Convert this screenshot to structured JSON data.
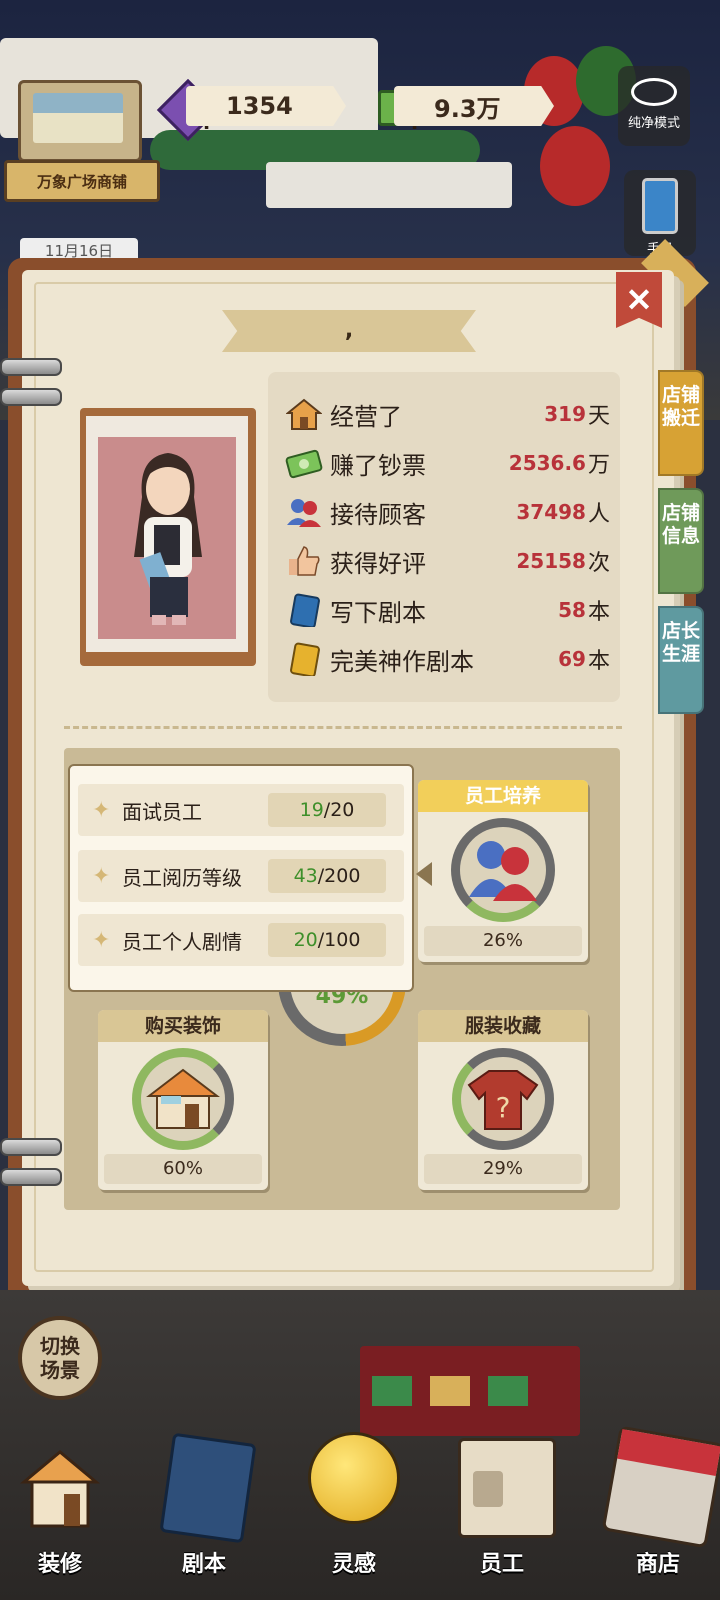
{
  "hud": {
    "shop_name": "万象广场商铺",
    "gems": "1354",
    "money": "9.3万",
    "date": "11月16日",
    "pure_mode": "纯净模式",
    "phone": "手机"
  },
  "panel": {
    "title": ",",
    "close": "✕",
    "tabs": [
      {
        "label": "店铺搬迁",
        "color": "#d7a234"
      },
      {
        "label": "店铺信息",
        "color": "#6f9a5a"
      },
      {
        "label": "店长生涯",
        "color": "#5f9aa0"
      }
    ],
    "stats": [
      {
        "label": "经营了",
        "value": "319",
        "unit": "天",
        "icon": "shop-icon"
      },
      {
        "label": "赚了钞票",
        "value": "2536.6",
        "unit": "万",
        "icon": "cash-icon"
      },
      {
        "label": "接待顾客",
        "value": "37498",
        "unit": "人",
        "icon": "customers-icon"
      },
      {
        "label": "获得好评",
        "value": "25158",
        "unit": "次",
        "icon": "thumbs-up-icon"
      },
      {
        "label": "写下剧本",
        "value": "58",
        "unit": "本",
        "icon": "script-book-icon"
      },
      {
        "label": "完美神作剧本",
        "value": "69",
        "unit": "本",
        "icon": "gold-script-icon"
      }
    ],
    "cards": {
      "staff_training": {
        "title": "员工培养",
        "percent": "26%"
      },
      "center": {
        "percent": "49%"
      },
      "buy_decor": {
        "title": "购买装饰",
        "percent": "60%"
      },
      "costume": {
        "title": "服装收藏",
        "percent": "29%"
      }
    },
    "tooltip": [
      {
        "label": "面试员工",
        "current": "19",
        "total": "/20"
      },
      {
        "label": "员工阅历等级",
        "current": "43",
        "total": "/200"
      },
      {
        "label": "员工个人剧情",
        "current": "20",
        "total": "/100"
      }
    ]
  },
  "switch_scene": "切换场景",
  "nav": [
    {
      "label": "装修",
      "icon": "house-icon"
    },
    {
      "label": "剧本",
      "icon": "script-icon"
    },
    {
      "label": "灵感",
      "icon": "lightbulb-icon"
    },
    {
      "label": "员工",
      "icon": "staff-card-icon"
    },
    {
      "label": "商店",
      "icon": "shop-box-icon"
    }
  ]
}
